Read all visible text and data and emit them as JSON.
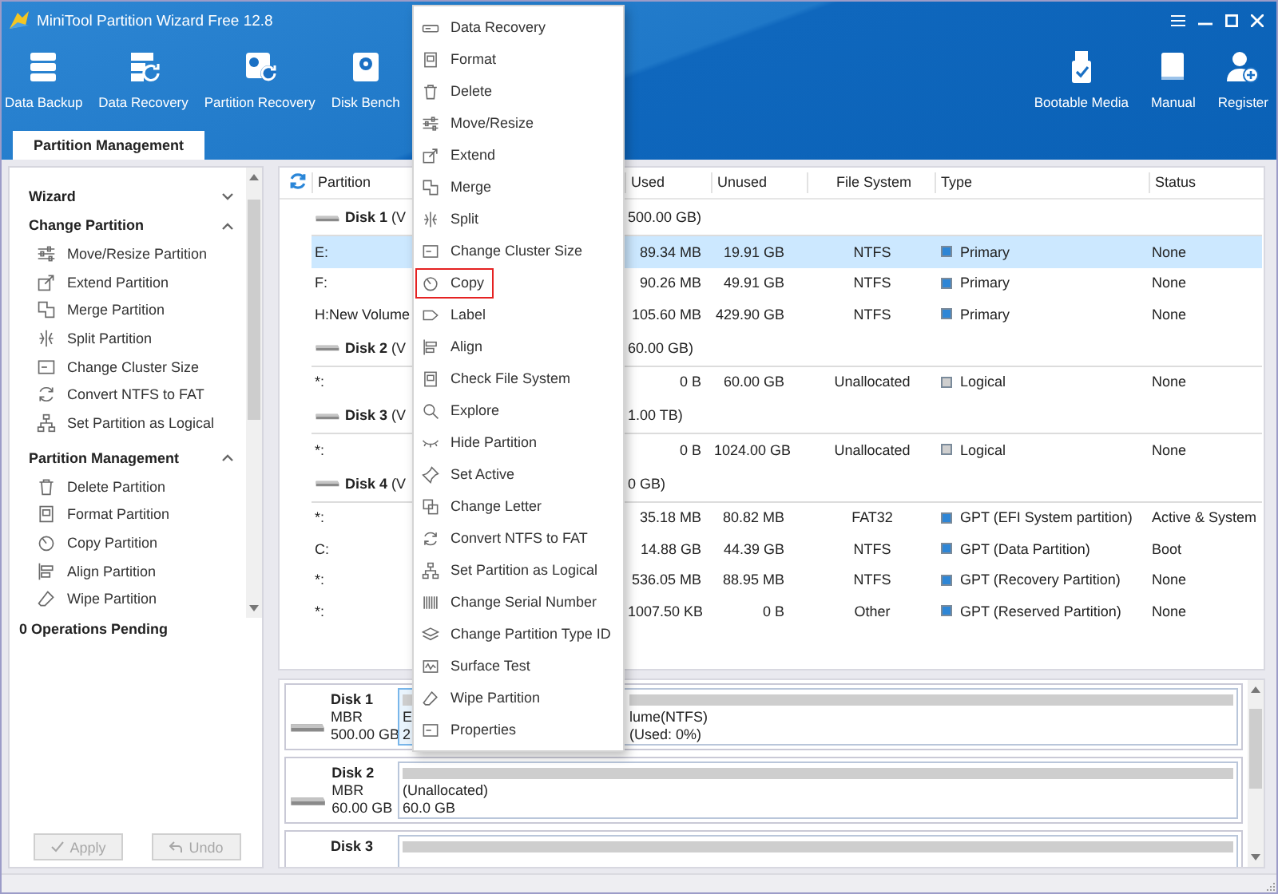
{
  "window": {
    "title": "MiniTool Partition Wizard Free 12.8"
  },
  "toolbar": {
    "left": [
      {
        "label": "Data Backup"
      },
      {
        "label": "Data Recovery"
      },
      {
        "label": "Partition Recovery"
      },
      {
        "label": "Disk Bench"
      }
    ],
    "right": [
      {
        "label": "Bootable Media"
      },
      {
        "label": "Manual"
      },
      {
        "label": "Register"
      }
    ]
  },
  "tabs": [
    {
      "label": "Partition Management",
      "selected": true
    }
  ],
  "sidebar": {
    "sections": [
      {
        "title": "Wizard",
        "expanded": false
      },
      {
        "title": "Change Partition",
        "expanded": true,
        "items": [
          "Move/Resize Partition",
          "Extend Partition",
          "Merge Partition",
          "Split Partition",
          "Change Cluster Size",
          "Convert NTFS to FAT",
          "Set Partition as Logical"
        ]
      },
      {
        "title": "Partition Management",
        "expanded": true,
        "items": [
          "Delete Partition",
          "Format Partition",
          "Copy Partition",
          "Align Partition",
          "Wipe Partition"
        ]
      }
    ],
    "pending": "0 Operations Pending",
    "buttons": [
      {
        "label": "Apply",
        "disabled": true
      },
      {
        "label": "Undo",
        "disabled": true
      }
    ]
  },
  "table": {
    "columns": [
      "Partition",
      "Used",
      "Unused",
      "File System",
      "Type",
      "Status"
    ],
    "rows": [
      {
        "kind": "disk",
        "label": "**Disk 1** (V",
        "detail": "500.00 GB)"
      },
      {
        "kind": "partition",
        "partition": "E:",
        "used": "89.34 MB",
        "unused": "19.91 GB",
        "file_system": "NTFS",
        "type": "Primary",
        "color": "#2e86d6",
        "status": "None",
        "selected": true
      },
      {
        "kind": "partition",
        "partition": "F:",
        "used": "90.26 MB",
        "unused": "49.91 GB",
        "file_system": "NTFS",
        "type": "Primary",
        "color": "#2e86d6",
        "status": "None",
        "selected": false
      },
      {
        "kind": "partition",
        "partition": "H:New Volume",
        "used": "105.60 MB",
        "unused": "429.90 GB",
        "file_system": "NTFS",
        "type": "Primary",
        "color": "#2e86d6",
        "status": "None",
        "selected": false
      },
      {
        "kind": "disk",
        "label": "**Disk 2** (V",
        "detail": "60.00 GB)"
      },
      {
        "kind": "partition",
        "partition": "*:",
        "used": "0 B",
        "unused": "60.00 GB",
        "file_system": "Unallocated",
        "type": "Logical",
        "color": "#cfcfcf",
        "status": "None",
        "selected": false
      },
      {
        "kind": "disk",
        "label": "**Disk 3** (V",
        "detail": "1.00 TB)"
      },
      {
        "kind": "partition",
        "partition": "*:",
        "used": "0 B",
        "unused": "1024.00 GB",
        "file_system": "Unallocated",
        "type": "Logical",
        "color": "#cfcfcf",
        "status": "None",
        "selected": false
      },
      {
        "kind": "disk",
        "label": "**Disk 4** (V",
        "detail": "0 GB)"
      },
      {
        "kind": "partition",
        "partition": "*:",
        "used": "35.18 MB",
        "unused": "80.82 MB",
        "file_system": "FAT32",
        "type": "GPT (EFI System partition)",
        "color": "#2e86d6",
        "status": "Active & System",
        "selected": false
      },
      {
        "kind": "partition",
        "partition": "C:",
        "used": "14.88 GB",
        "unused": "44.39 GB",
        "file_system": "NTFS",
        "type": "GPT (Data Partition)",
        "color": "#2e86d6",
        "status": "Boot",
        "selected": false
      },
      {
        "kind": "partition",
        "partition": "*:",
        "used": "536.05 MB",
        "unused": "88.95 MB",
        "file_system": "NTFS",
        "type": "GPT (Recovery Partition)",
        "color": "#2e86d6",
        "status": "None",
        "selected": false
      },
      {
        "kind": "partition",
        "partition": "*:",
        "used": "1007.50 KB",
        "unused": "0 B",
        "file_system": "Other",
        "type": "GPT (Reserved Partition)",
        "color": "#2e86d6",
        "status": "None",
        "selected": false
      }
    ]
  },
  "disk_map": [
    {
      "name": "Disk 1",
      "style": "MBR",
      "size": "500.00 GB",
      "blocks": [
        {
          "lines": [
            "E",
            "2"
          ],
          "selected": true
        },
        {
          "lines": [
            "lume(NTFS)",
            "(Used: 0%)"
          ],
          "selected": false
        }
      ]
    },
    {
      "name": "Disk 2",
      "style": "MBR",
      "size": "60.00 GB",
      "blocks": [
        {
          "lines": [
            "(Unallocated)",
            "60.0 GB"
          ],
          "selected": false
        }
      ]
    },
    {
      "name": "Disk 3",
      "blocks": [
        {
          "selected": false
        }
      ]
    }
  ],
  "context_menu": {
    "items": [
      {
        "label": "Data Recovery",
        "selected": false
      },
      {
        "label": "Format",
        "selected": false
      },
      {
        "label": "Delete",
        "selected": false
      },
      {
        "label": "Move/Resize",
        "selected": false
      },
      {
        "label": "Extend",
        "selected": false
      },
      {
        "label": "Merge",
        "selected": false
      },
      {
        "label": "Split",
        "selected": false
      },
      {
        "label": "Change Cluster Size",
        "selected": false
      },
      {
        "label": "Copy",
        "selected": true
      },
      {
        "label": "Label",
        "selected": false
      },
      {
        "label": "Align",
        "selected": false
      },
      {
        "label": "Check File System",
        "selected": false
      },
      {
        "label": "Explore",
        "selected": false
      },
      {
        "label": "Hide Partition",
        "selected": false
      },
      {
        "label": "Set Active",
        "selected": false
      },
      {
        "label": "Change Letter",
        "selected": false
      },
      {
        "label": "Convert NTFS to FAT",
        "selected": false
      },
      {
        "label": "Set Partition as Logical",
        "selected": false
      },
      {
        "label": "Change Serial Number",
        "selected": false
      },
      {
        "label": "Change Partition Type ID",
        "selected": false
      },
      {
        "label": "Surface Test",
        "selected": false
      },
      {
        "label": "Wipe Partition",
        "selected": false
      },
      {
        "label": "Properties",
        "selected": false
      }
    ]
  }
}
